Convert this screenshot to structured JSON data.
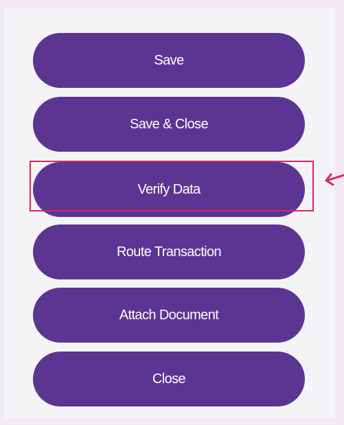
{
  "buttons": [
    {
      "label": "Save"
    },
    {
      "label": "Save & Close"
    },
    {
      "label": "Verify Data"
    },
    {
      "label": "Route Transaction"
    },
    {
      "label": "Attach Document"
    },
    {
      "label": "Close"
    }
  ],
  "highlight": {
    "target": "Verify Data",
    "color": "#e0225f"
  },
  "colors": {
    "button_bg": "#5c3592",
    "button_text": "#ffffff",
    "panel_bg": "#f4f4f6",
    "page_bg": "#f3e9f2",
    "annotation": "#e0225f"
  },
  "icons": {
    "pointer": "arrow-pointer-icon"
  }
}
